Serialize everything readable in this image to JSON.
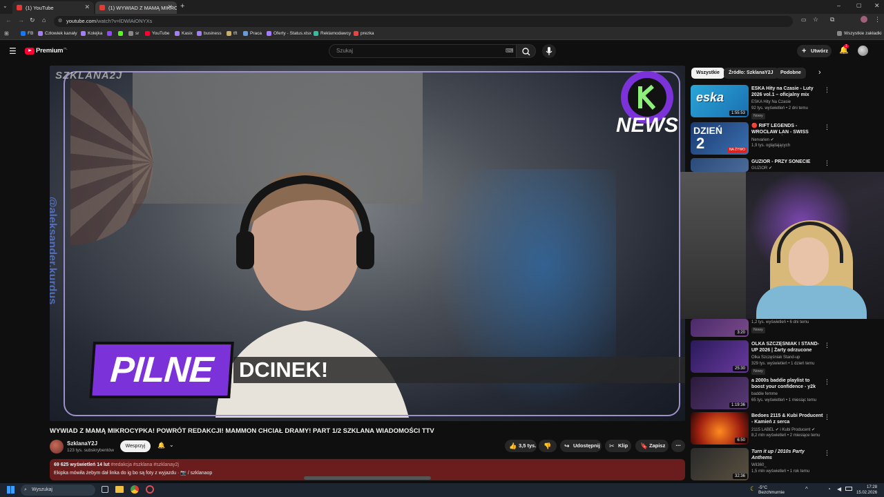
{
  "browser": {
    "tabs": [
      {
        "label": "(1) YouTube",
        "active": false
      },
      {
        "label": "(1) WYWIAD Z MAMĄ MIKROC",
        "active": true
      }
    ],
    "url_host": "youtube.com",
    "url_path": "/watch?v=lDWlAiONYXs",
    "bookmarks": [
      "FB",
      "Człowiek kanały",
      "Kolejka",
      "sr",
      "YouTube",
      "Kasix",
      "business",
      "tft",
      "Praca",
      "Oferty - Status.xlsx",
      "Reklamodawcy",
      "prezka"
    ],
    "all_bookmarks": "Wszystkie zakładki"
  },
  "masthead": {
    "logo": "Premium",
    "logo_sup": "PL",
    "search_placeholder": "Szukaj",
    "create": "Utwórz",
    "notif_count": "1"
  },
  "video": {
    "watermark": "SZKLANA2J",
    "news_logo": "NEWS",
    "banner": "PILNE",
    "ticker": "DCINEK!",
    "side_text": "@aleksander.kurdus"
  },
  "watch": {
    "title": "WYWIAD Z MAMĄ MIKROCYPKA! POWRÓT REDAKCJI! MAMMON CHCIAŁ DRAMY! PART 1/2 SZKLANA WIADOMOŚCI TTV",
    "channel": "SzklanaY2J",
    "subs": "123 tys. subskrybentów",
    "support": "Wesprzyj",
    "likes": "3,5 tys.",
    "share": "Udostępnij",
    "clip": "Klip",
    "save": "Zapisz",
    "views_date": "69 625 wyświetleń  14 lut",
    "tags": "#redakcja #szklana #szklanay2j",
    "desc": "Ekipka mówiła żebym dał linka do ig bo są foty z wyjazdu · 📷 / szklanaop"
  },
  "chips": [
    "Wszystkie",
    "Źródło: SzklanaY2J",
    "Podobne"
  ],
  "recs": [
    {
      "title": "ESKA Hity na Czasie - Luty 2026 vol.1 – oficjalny mix Radia ESKA",
      "channel": "ESKA Hity Na Czasie",
      "meta": "92 tys. wyświetleń • 2 dni temu",
      "badge": "Nowy",
      "dur": "1:55:53"
    },
    {
      "title": "🔴 RIFT LEGENDS - WROCŁAW LAN - SWISS STAGE DZIEŃ 2 ...",
      "channel": "Nervarien ✔",
      "meta": "1,9 tys. oglądających",
      "badge": "",
      "dur": ""
    },
    {
      "title": "GUZIOR - PRZY SONECIE",
      "channel": "GUZIOR ✔",
      "meta": "",
      "badge": "",
      "dur": ""
    },
    {
      "title": "",
      "channel": "",
      "meta": "1,2 tys. wyświetleń • 6 dni temu",
      "badge": "Nowy",
      "dur": "3:20"
    },
    {
      "title": "OLKA SZCZĘŚNIAK I STAND-UP 2026 | Żarty odrzucone",
      "channel": "Olka Szczęśniak Stand-up",
      "meta": "329 tys. wyświetleń • 1 dzień temu",
      "badge": "Nowy",
      "dur": "25:30"
    },
    {
      "title": "a 2000s baddie playlist to boost your confidence - y2k playlist",
      "channel": "baddie femme",
      "meta": "65 tys. wyświetleń • 1 miesiąc temu",
      "badge": "",
      "dur": "1:19:36"
    },
    {
      "title": "Bedoes 2115 & Kubi Producent - Kamień z serca",
      "channel": "2115 LABEL ✔ i Kubi Producent ✔",
      "meta": "8,2 mln wyświetleń • 2 miesiące temu",
      "badge": "",
      "dur": "6:50"
    },
    {
      "title": "Turn it up / 2010s Party Anthems",
      "channel": "Wil360_",
      "meta": "1,5 mln wyświetleń • 1 rok temu",
      "badge": "",
      "dur": "32:36"
    }
  ],
  "taskbar": {
    "search": "Wyszukaj",
    "temp": "-5°C",
    "weather": "Bezchmurnie",
    "time": "17:28",
    "date": "15.02.2026"
  },
  "colors": {
    "accent_red": "#ff0033",
    "banner_purple": "#7b33d9",
    "desc_bg": "#6b1c1c"
  }
}
